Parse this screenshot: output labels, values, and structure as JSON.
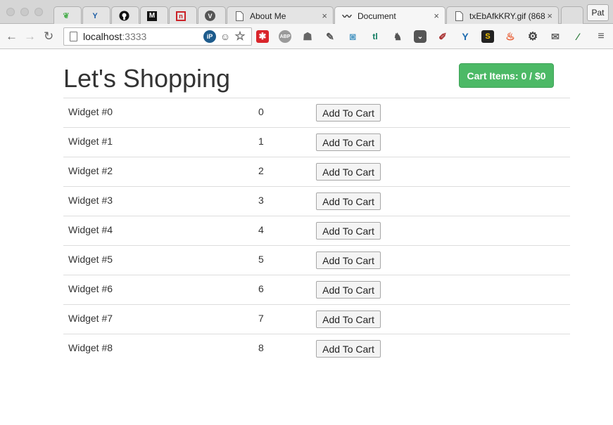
{
  "browser": {
    "tabs": [
      {
        "label": "",
        "icon": "leaf-icon",
        "active": false
      },
      {
        "label": "",
        "icon": "y-combinator-icon",
        "active": false
      },
      {
        "label": "",
        "icon": "github-icon",
        "active": false
      },
      {
        "label": "",
        "icon": "medium-icon",
        "active": false
      },
      {
        "label": "",
        "icon": "npm-icon",
        "active": false
      },
      {
        "label": "",
        "icon": "v-icon",
        "active": false
      },
      {
        "label": "About Me",
        "icon": "page-icon",
        "active": false
      },
      {
        "label": "Document",
        "icon": "mustache-icon",
        "active": true
      },
      {
        "label": "txEbAfkKRY.gif (868×",
        "icon": "page-icon",
        "active": false
      }
    ],
    "profile_label": "Pat",
    "url_host": "localhost",
    "url_port": ":3333"
  },
  "page": {
    "title": "Let's Shopping",
    "cart_button_label": "Cart Items: 0 / $0",
    "add_button_label": "Add To Cart",
    "products": [
      {
        "name": "Widget #0",
        "qty": "0"
      },
      {
        "name": "Widget #1",
        "qty": "1"
      },
      {
        "name": "Widget #2",
        "qty": "2"
      },
      {
        "name": "Widget #3",
        "qty": "3"
      },
      {
        "name": "Widget #4",
        "qty": "4"
      },
      {
        "name": "Widget #5",
        "qty": "5"
      },
      {
        "name": "Widget #6",
        "qty": "6"
      },
      {
        "name": "Widget #7",
        "qty": "7"
      },
      {
        "name": "Widget #8",
        "qty": "8"
      }
    ]
  },
  "colors": {
    "cart_button": "#4cb966",
    "row_border": "#dddddd"
  }
}
